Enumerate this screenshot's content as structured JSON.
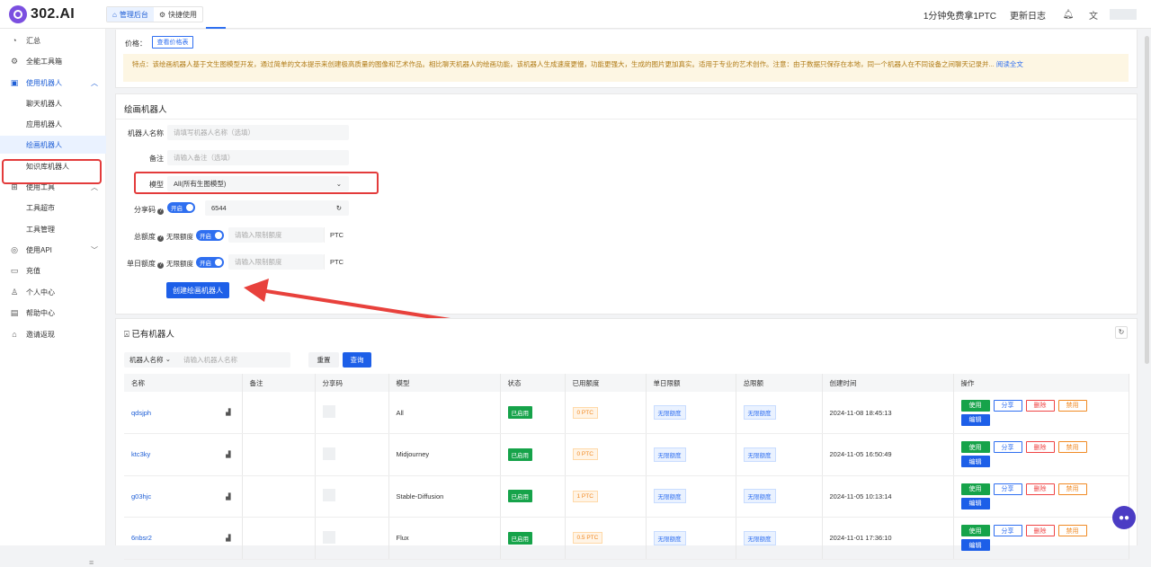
{
  "app": {
    "title": "302.AI"
  },
  "header": {
    "tabs": [
      {
        "label": "管理后台"
      },
      {
        "label": "快捷使用"
      }
    ],
    "free_link": "1分钟免费拿1PTC",
    "changelog": "更新日志"
  },
  "sidebar": {
    "items": [
      {
        "label": "汇总",
        "icon": "gauge-icon"
      },
      {
        "label": "全能工具箱",
        "icon": "settings-icon"
      },
      {
        "label": "使用机器人",
        "icon": "robot-icon"
      },
      {
        "label": "聊天机器人"
      },
      {
        "label": "应用机器人"
      },
      {
        "label": "绘画机器人"
      },
      {
        "label": "知识库机器人"
      },
      {
        "label": "使用工具",
        "icon": "grid-icon"
      },
      {
        "label": "工具超市"
      },
      {
        "label": "工具管理"
      },
      {
        "label": "使用API",
        "icon": "globe-icon"
      },
      {
        "label": "充值",
        "icon": "wallet-icon"
      },
      {
        "label": "个人中心",
        "icon": "user-icon"
      },
      {
        "label": "帮助中心",
        "icon": "book-icon"
      },
      {
        "label": "邀请返现",
        "icon": "gift-icon"
      }
    ]
  },
  "intro": {
    "price_label": "价格：",
    "price_button": "查看价格表",
    "notice": "特点：该绘画机器人基于文生图模型开发，通过简单的文本提示来创建极高质量的图像和艺术作品。相比聊天机器人的绘画功能，该机器人生成速度更慢，功能更强大，生成的图片更加真实。适用于专业的艺术创作。注意：由于数据只保存在本地，同一个机器人在不同设备之间聊天记录并...",
    "read_more": "阅读全文"
  },
  "form": {
    "title": "绘画机器人",
    "name_label": "机器人名称",
    "name_placeholder": "请填写机器人名称（选填）",
    "remark_label": "备注",
    "remark_placeholder": "请输入备注（选填）",
    "model_label": "模型",
    "model_value": "All(所有生图模型)",
    "share_label": "分享码",
    "share_switch": "开启",
    "share_code": "6544",
    "total_label": "总额度",
    "total_unlimited": "无限额度",
    "total_switch": "开启",
    "total_placeholder": "请输入限制额度",
    "total_unit": "PTC",
    "daily_label": "单日额度",
    "daily_unlimited": "无限额度",
    "daily_switch": "开启",
    "daily_placeholder": "请输入限制额度",
    "daily_unit": "PTC",
    "create_button": "创建绘画机器人"
  },
  "list": {
    "title": "已有机器人",
    "search_key": "机器人名称",
    "search_placeholder": "请输入机器人名称",
    "reset": "重置",
    "query": "查询",
    "columns": [
      "名称",
      "备注",
      "分享码",
      "模型",
      "状态",
      "已用额度",
      "单日限额",
      "总限额",
      "创建时间",
      "操作"
    ],
    "rows": [
      {
        "name": "qdsjph",
        "model": "All",
        "status": "已启用",
        "used": "0 PTC",
        "daily": "无限额度",
        "total": "无限额度",
        "created": "2024-11-08 18:45:13"
      },
      {
        "name": "ktc3ky",
        "model": "Midjourney",
        "status": "已启用",
        "used": "0 PTC",
        "daily": "无限额度",
        "total": "无限额度",
        "created": "2024-11-05 16:50:49"
      },
      {
        "name": "g03hjc",
        "model": "Stable-Diffusion",
        "status": "已启用",
        "used": "1 PTC",
        "daily": "无限额度",
        "total": "无限额度",
        "created": "2024-11-05 10:13:14"
      },
      {
        "name": "6nbsr2",
        "model": "Flux",
        "status": "已启用",
        "used": "0.5 PTC",
        "daily": "无限额度",
        "total": "无限额度",
        "created": "2024-11-01 17:36:10"
      }
    ],
    "actions": {
      "use": "使用",
      "share": "分享",
      "delete": "删除",
      "disable": "禁用",
      "edit": "编辑"
    }
  },
  "colors": {
    "primary": "#1d5fe8",
    "highlight": "#e33b3b",
    "success": "#16a34a",
    "warning": "#f08a24"
  }
}
